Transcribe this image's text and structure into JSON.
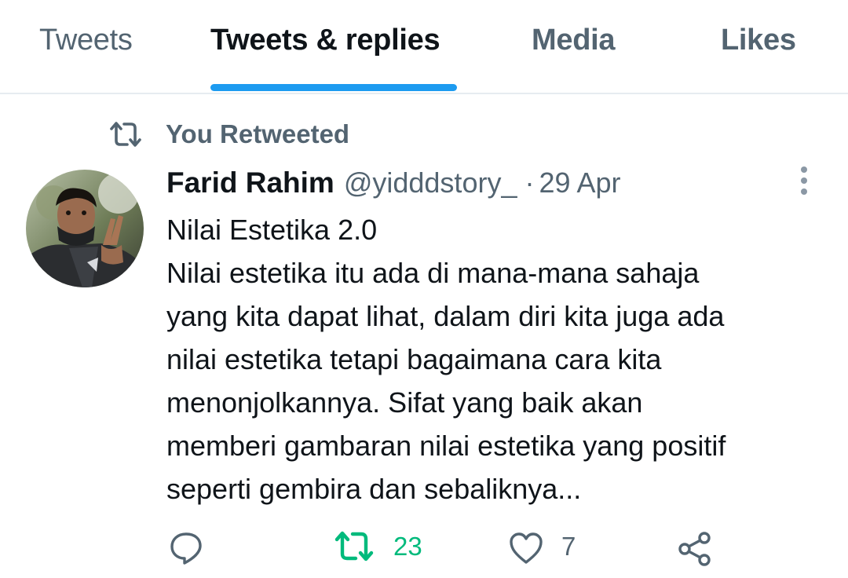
{
  "tabs": [
    {
      "label": "Tweets",
      "active": false
    },
    {
      "label": "Tweets & replies",
      "active": true
    },
    {
      "label": "Media",
      "active": false
    },
    {
      "label": "Likes",
      "active": false
    }
  ],
  "accent_color": "#1d9bf0",
  "retweet_context": {
    "icon": "retweet-icon",
    "label": "You Retweeted"
  },
  "tweet": {
    "avatar": "profile-photo",
    "display_name": "Farid Rahim",
    "handle": "@yidddstory_",
    "separator": "·",
    "date": "29 Apr",
    "text_lines": [
      "Nilai Estetika 2.0",
      "Nilai estetika itu ada di mana-mana sahaja",
      "yang kita dapat lihat, dalam diri kita juga ada",
      "nilai estetika tetapi bagaimana cara kita",
      "menonjolkannya. Sifat yang baik akan",
      "memberi gambaran nilai estetika yang positif",
      "seperti gembira dan sebaliknya..."
    ],
    "actions": {
      "reply": {
        "icon": "reply-icon"
      },
      "retweet": {
        "icon": "retweet-icon",
        "count": "23",
        "active": true,
        "color": "#00ba7c"
      },
      "like": {
        "icon": "heart-icon",
        "count": "7"
      },
      "share": {
        "icon": "share-icon"
      }
    }
  }
}
